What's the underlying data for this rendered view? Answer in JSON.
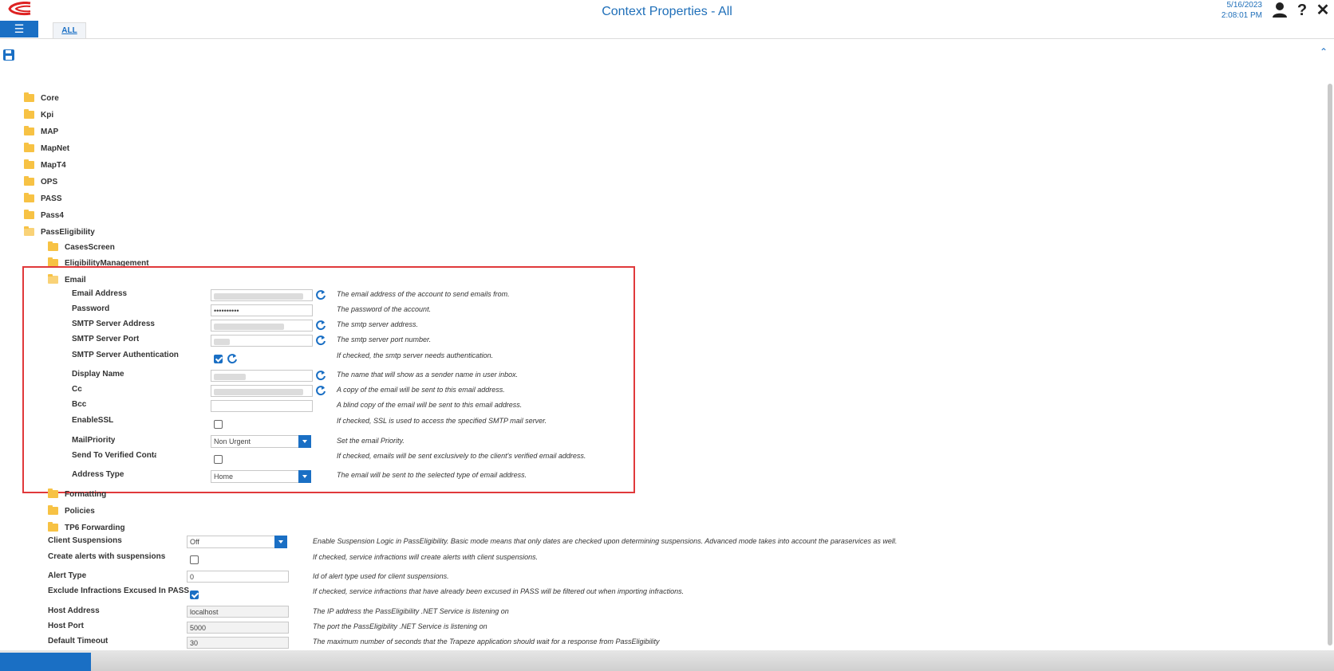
{
  "header": {
    "title": "Context Properties - All",
    "date": "5/16/2023",
    "time": "2:08:01 PM",
    "menu_icon": "hamburger-icon",
    "tab_all": "ALL",
    "user_icon": "user-icon",
    "help_icon": "?",
    "close_icon": "✕"
  },
  "toolbar": {
    "save_icon": "save-icon",
    "collapse_icon": "chevron-up-icon"
  },
  "tree": {
    "top": [
      "Core",
      "Kpi",
      "MAP",
      "MapNet",
      "MapT4",
      "OPS",
      "PASS",
      "Pass4",
      "PassEligibility"
    ],
    "pass_children": [
      "CasesScreen",
      "EligibilityManagement",
      "Email",
      "Formatting",
      "Policies",
      "TP6 Forwarding"
    ]
  },
  "email": {
    "rows": [
      {
        "label": "Email Address",
        "value": "",
        "desc": "The email address of the account to send emails from."
      },
      {
        "label": "Password",
        "value": "••••••••••",
        "desc": "The password of the account."
      },
      {
        "label": "SMTP Server Address",
        "value": "",
        "desc": "The smtp server address."
      },
      {
        "label": "SMTP Server Port",
        "value": "",
        "desc": "The smtp server port number."
      },
      {
        "label": "SMTP Server Authentication",
        "value": "",
        "desc": "If checked, the smtp server needs authentication."
      },
      {
        "label": "Display Name",
        "value": "",
        "desc": "The name that will show as a sender name in user inbox."
      },
      {
        "label": "Cc",
        "value": "",
        "desc": "A copy of the email will be sent to this email address."
      },
      {
        "label": "Bcc",
        "value": "",
        "desc": "A blind copy of the email will be sent to this email address."
      },
      {
        "label": "EnableSSL",
        "value": "",
        "desc": "If checked, SSL is used to access the specified SMTP mail server."
      },
      {
        "label": "MailPriority",
        "value": "Non Urgent",
        "desc": "Set the email Priority."
      },
      {
        "label": "Send To Verified Contact",
        "value": "",
        "desc": "If checked, emails will be sent exclusively to the client's verified email address."
      },
      {
        "label": "Address Type",
        "value": "Home",
        "desc": "The email will be sent to the selected type of email address."
      }
    ]
  },
  "pass_props": [
    {
      "label": "Client Suspensions",
      "value": "Off",
      "desc": "Enable Suspension Logic in PassEligibility. Basic mode means that only dates are checked upon determining suspensions. Advanced mode takes into account the paraservices as well."
    },
    {
      "label": "Create alerts with suspensions",
      "value": "",
      "desc": "If checked, service infractions will create alerts with client suspensions."
    },
    {
      "label": "Alert Type",
      "value": "0",
      "desc": "Id of alert type used for client suspensions."
    },
    {
      "label": "Exclude Infractions Excused In PASS",
      "value": "",
      "desc": "If checked, service infractions that have already been excused in PASS will be filtered out when importing infractions."
    },
    {
      "label": "Host Address",
      "value": "localhost",
      "desc": "The IP address the PassEligibility .NET Service is listening on"
    },
    {
      "label": "Host Port",
      "value": "5000",
      "desc": "The port the PassEligibility .NET Service is listening on"
    },
    {
      "label": "Default Timeout",
      "value": "30",
      "desc": "The maximum number of seconds that the Trapeze application should wait for a response from PassEligibility"
    }
  ],
  "colors": {
    "accent": "#1a6fc4",
    "title": "#1f6fb9",
    "highlight": "#e0393b",
    "folder": "#f7c244"
  }
}
